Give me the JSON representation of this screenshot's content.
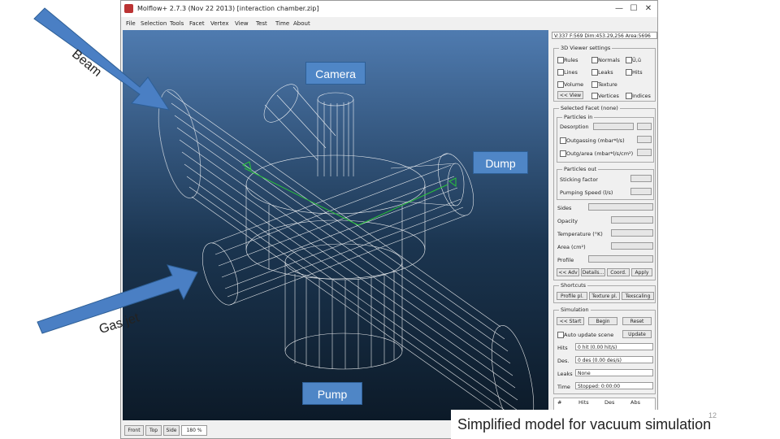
{
  "window": {
    "title": "Molflow+ 2.7.3 (Nov 22 2013) [interaction chamber.zip]",
    "minimize": "—",
    "maximize": "☐",
    "close": "✕"
  },
  "menu": [
    "File",
    "Selection",
    "Tools",
    "Facet",
    "Vertex",
    "View",
    "Test",
    "Time",
    "About"
  ],
  "viewer_toolbar": {
    "front": "Front",
    "top": "Top",
    "side": "Side",
    "zoom": "180 %"
  },
  "panel": {
    "info": "V:337 F:569 Dim:453.29,256 Area:5696",
    "viewer_settings": {
      "title": "3D Viewer settings",
      "rules": "Rules",
      "normals": "Normals",
      "uv": "Ū,ū",
      "lines": "Lines",
      "leaks": "Leaks",
      "hits": "Hits",
      "volume": "Volume",
      "texture": "Texture",
      "view_btn": "<< View",
      "vertices": "Vertices",
      "indices": "Indices"
    },
    "selected_facet": {
      "title": "Selected Facet (none)",
      "particles_in": "Particles in",
      "desorption": "Desorption",
      "outgassing": "Outgassing (mbar*l/s)",
      "outgassing_area": "Outg/area (mbar*l/s/cm²)",
      "particles_out": "Particles out",
      "sticking": "Sticking factor",
      "pumping": "Pumping Speed (l/s)",
      "sides": "Sides",
      "opacity": "Opacity",
      "temperature": "Temperature (°K)",
      "area": "Area (cm²)",
      "profile": "Profile",
      "adv_btn": "<< Adv",
      "details_btn": "Details...",
      "coord_btn": "Coord.",
      "apply_btn": "Apply"
    },
    "shortcuts": {
      "title": "Shortcuts",
      "profile_plot": "Profile pl.",
      "texture_plot": "Texture pl.",
      "texscaling": "Texscaling"
    },
    "simulation": {
      "title": "Simulation",
      "start": "<< Start",
      "begin": "Begin",
      "reset": "Reset",
      "auto_update": "Auto update scene",
      "update_btn": "Update",
      "hits_label": "Hits",
      "hits_value": "0 hit (0.00 hit/s)",
      "des_label": "Des.",
      "des_value": "0 des (0.00 des/s)",
      "leaks_label": "Leaks",
      "leaks_value": "None",
      "time_label": "Time",
      "time_value": "Stopped: 0:00:00"
    },
    "table_headers": [
      "#",
      "Hits",
      "Des",
      "Abs"
    ]
  },
  "callouts": {
    "camera": "Camera",
    "dump": "Dump",
    "pump": "Pump"
  },
  "arrows": {
    "beam": "Beam",
    "gas_jet": "Gas jet"
  },
  "caption": "Simplified model for vacuum simulation",
  "page_number": "12",
  "colors": {
    "arrow": "#4a7fc4",
    "callout": "#4f86c6",
    "viewer_top": "#4f7bb0",
    "viewer_bottom": "#0c1a28",
    "wireframe": "#ffffff",
    "axis": "#29c43a"
  }
}
